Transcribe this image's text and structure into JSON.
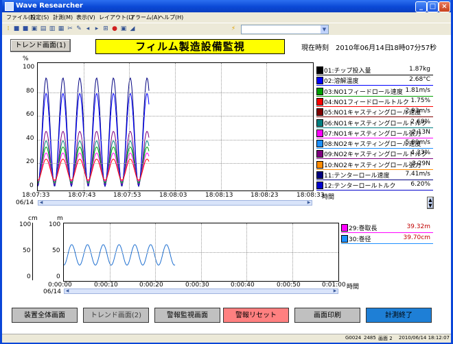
{
  "window": {
    "title": "Wave Researcher"
  },
  "menu": [
    "ファイル(F)",
    "設定(S)",
    "計測(M)",
    "表示(V)",
    "レイアウト(L)",
    "アラーム(A)",
    "ヘルプ(H)"
  ],
  "toolbar": {
    "icons": [
      "stop-icon",
      "record-icon",
      "open-icon",
      "save-icon",
      "print-preview-icon",
      "print-icon",
      "cut-icon",
      "edit-icon",
      "back-icon",
      "forward-icon",
      "zoom-icon",
      "record-red-icon",
      "monitor-icon",
      "chart-icon"
    ],
    "combo_value": ""
  },
  "header": {
    "trend_button": "トレンド画面(1)",
    "banner": "フィルム製造設備監視",
    "clock_label": "現在時刻",
    "clock_date": "2010年06月14日",
    "clock_time": "18時07分57秒"
  },
  "chart1": {
    "y_unit": "%",
    "y_ticks": [
      "100",
      "80",
      "60",
      "40",
      "20",
      "0"
    ],
    "x_ticks": [
      "18:07:33",
      "18:07:43",
      "18:07:53",
      "18:08:03",
      "18:08:13",
      "18:08:23",
      "18:08:33"
    ],
    "date": "06/14",
    "x_label": "時間",
    "legend": [
      {
        "name": "01:チップ投入量",
        "value": "1.87kg",
        "color": "#000000"
      },
      {
        "name": "02:溶解温度",
        "value": "2.68°C",
        "color": "#0000ff"
      },
      {
        "name": "03:NO1フィードロール速度",
        "value": "1.81m/s",
        "color": "#00a000"
      },
      {
        "name": "04:NO1フィードロールトルク",
        "value": "1.75%",
        "color": "#ff0000"
      },
      {
        "name": "05:NO1キャスティングロール速度",
        "value": "2.93m/s",
        "color": "#800000"
      },
      {
        "name": "06:NO1キャスティングロールトルク",
        "value": "2.68%",
        "color": "#008080"
      },
      {
        "name": "07:NO1キャスティングロール張力",
        "value": "2.13N",
        "color": "#ff00ff"
      },
      {
        "name": "08:NO2キャスティングロール速度",
        "value": "5.00m/s",
        "color": "#1e90ff"
      },
      {
        "name": "09:NO2キャスティングロールトルク",
        "value": "4.33%",
        "color": "#800080"
      },
      {
        "name": "10:NO2キャスティングロール張力",
        "value": "3.29N",
        "color": "#ff8c00"
      },
      {
        "name": "11:テンターロール速度",
        "value": "7.41m/s",
        "color": "#000080"
      },
      {
        "name": "12:テンターロールトルク",
        "value": "6.20%",
        "color": "#0000cd"
      }
    ]
  },
  "chart2": {
    "left_unit": "cm",
    "left_ticks": [
      "100",
      "50",
      "0"
    ],
    "y_unit": "m",
    "y_ticks": [
      "100",
      "50",
      "0"
    ],
    "x_ticks": [
      "0:00:00",
      "0:00:10",
      "0:00:20",
      "0:00:30",
      "0:00:40",
      "0:00:50",
      "0:01:00"
    ],
    "date": "06/14",
    "x_label": "時間",
    "legend": [
      {
        "name": "29:巻取長",
        "value": "39.32m",
        "color": "#ff00ff"
      },
      {
        "name": "30:巻径",
        "value": "39.70cm",
        "color": "#1e90ff"
      }
    ]
  },
  "bottom_buttons": [
    {
      "label": "装置全体画面",
      "bg": "#c0c0c0",
      "fg": "#000000"
    },
    {
      "label": "トレンド画面(2)",
      "bg": "#c0c0c0",
      "fg": "#404040"
    },
    {
      "label": "警報監視画面",
      "bg": "#c0c0c0",
      "fg": "#000000"
    },
    {
      "label": "警報リセット",
      "bg": "#ff8080",
      "fg": "#000000"
    },
    {
      "label": "画面印刷",
      "bg": "#c0c0c0",
      "fg": "#000000"
    },
    {
      "label": "計測終了",
      "bg": "#1e7fd6",
      "fg": "#000000"
    }
  ],
  "status": {
    "code": "G0024",
    "num": "2485",
    "screen": "画面 2",
    "datetime": "2010/06/14  18:12:07"
  }
}
